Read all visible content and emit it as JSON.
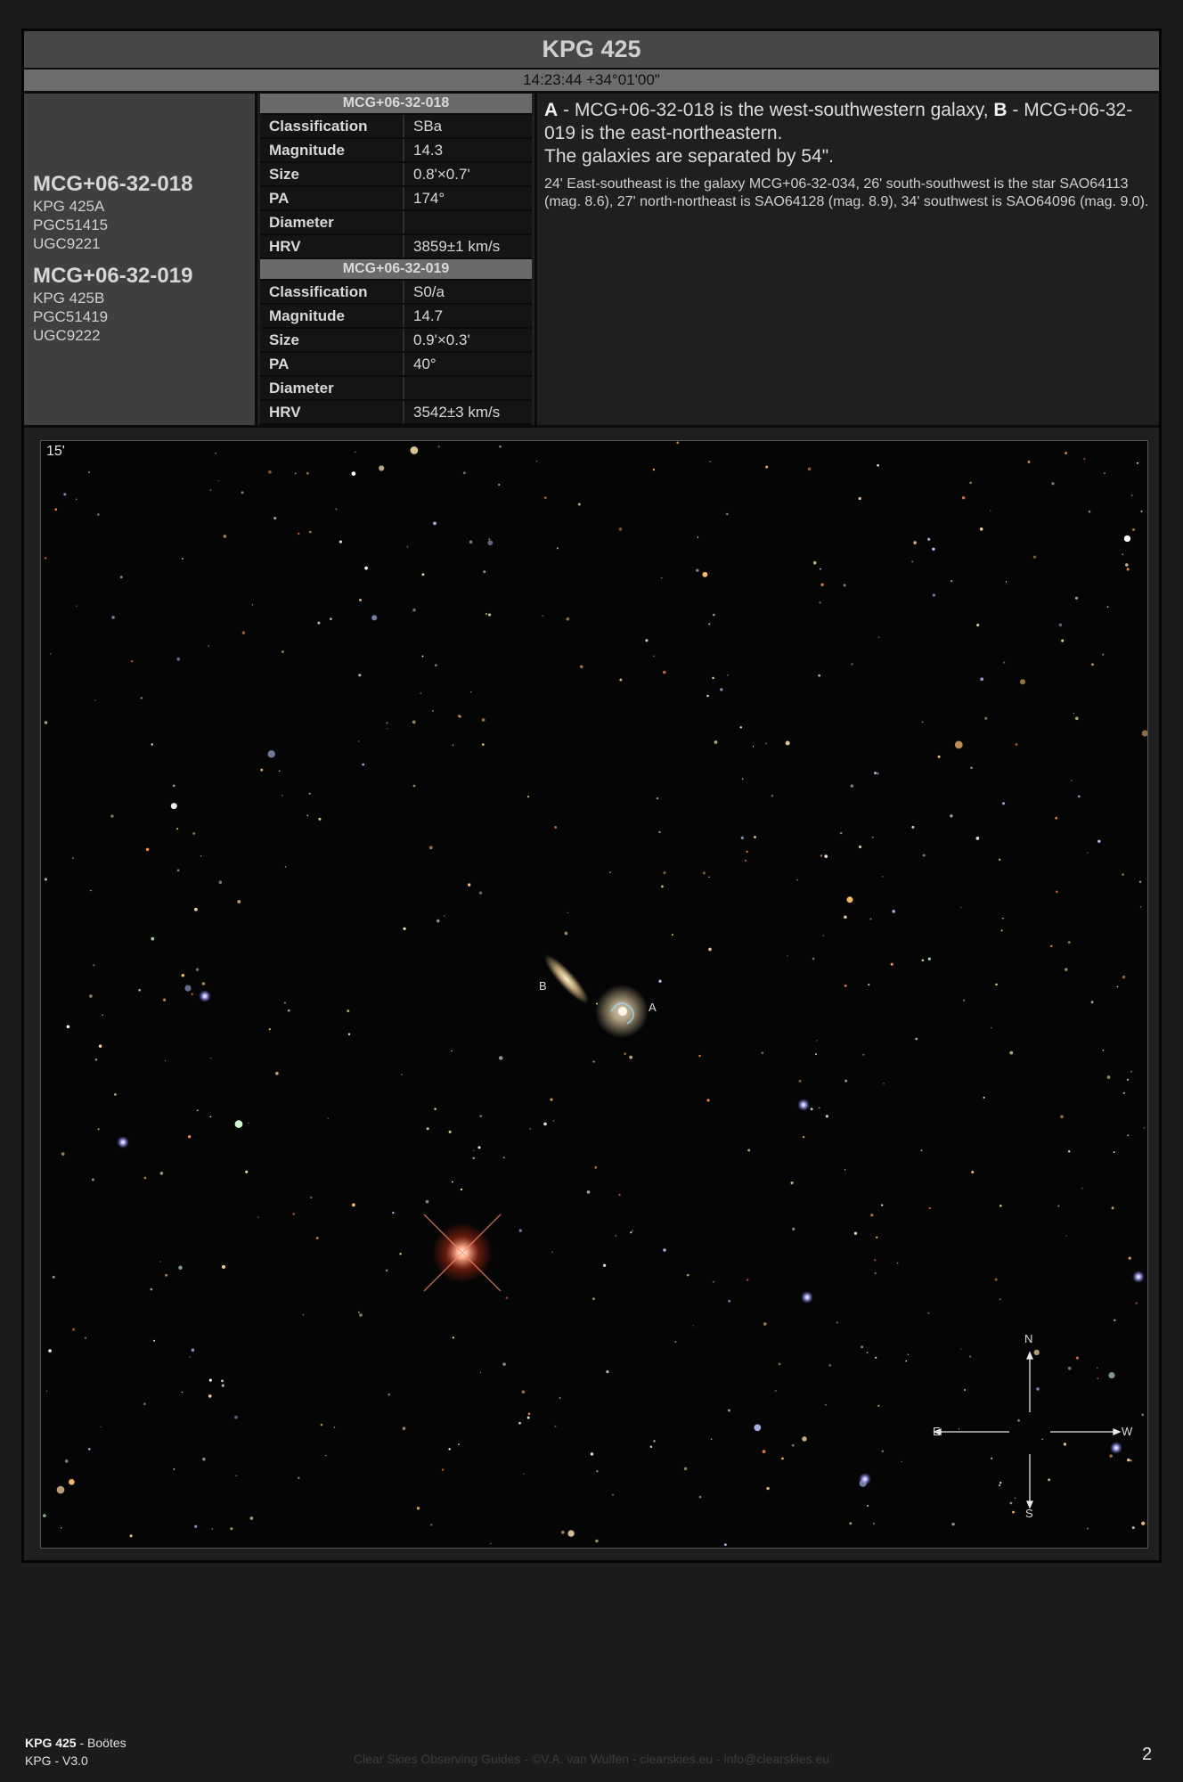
{
  "header": {
    "title": "KPG 425",
    "coords": "14:23:44 +34°01'00\""
  },
  "names": {
    "a": {
      "main": "MCG+06-32-018",
      "aliases": [
        "KPG 425A",
        "PGC51415",
        "UGC9221"
      ]
    },
    "b": {
      "main": "MCG+06-32-019",
      "aliases": [
        "KPG 425B",
        "PGC51419",
        "UGC9222"
      ]
    }
  },
  "galaxy_a": {
    "title": "MCG+06-32-018",
    "rows": [
      {
        "k": "Classification",
        "v": "SBa"
      },
      {
        "k": "Magnitude",
        "v": "14.3"
      },
      {
        "k": "Size",
        "v": "0.8'×0.7'"
      },
      {
        "k": "PA",
        "v": "174°"
      },
      {
        "k": "Diameter",
        "v": ""
      },
      {
        "k": "HRV",
        "v": "3859±1 km/s"
      }
    ]
  },
  "galaxy_b": {
    "title": "MCG+06-32-019",
    "rows": [
      {
        "k": "Classification",
        "v": "S0/a"
      },
      {
        "k": "Magnitude",
        "v": "14.7"
      },
      {
        "k": "Size",
        "v": "0.9'×0.3'"
      },
      {
        "k": "PA",
        "v": "40°"
      },
      {
        "k": "Diameter",
        "v": ""
      },
      {
        "k": "HRV",
        "v": "3542±3 km/s"
      }
    ]
  },
  "description": {
    "a_letter": "A",
    "a_text": " - MCG+06-32-018 is the west-southwestern galaxy, ",
    "b_letter": "B",
    "b_text": " - MCG+06-32-019 is the east-northeastern.",
    "separation": "The galaxies are separated by 54\".",
    "detail": "24' East-southeast is the galaxy MCG+06-32-034, 26' south-southwest is the star SAO64113 (mag. 8.6), 27' north-northeast is SAO64128 (mag. 8.9), 34' southwest is SAO64096 (mag. 9.0)."
  },
  "image": {
    "scale": "15'",
    "label_a": "A",
    "label_b": "B",
    "compass": {
      "n": "N",
      "s": "S",
      "e": "E",
      "w": "W"
    }
  },
  "footer": {
    "object": "KPG 425",
    "constellation": " - Boötes",
    "catalog": "KPG - V3.0",
    "credit": "Clear Skies Observing Guides - ©V.A. van Wulfen - clearskies.eu - info@clearskies.eu",
    "page": "2"
  }
}
